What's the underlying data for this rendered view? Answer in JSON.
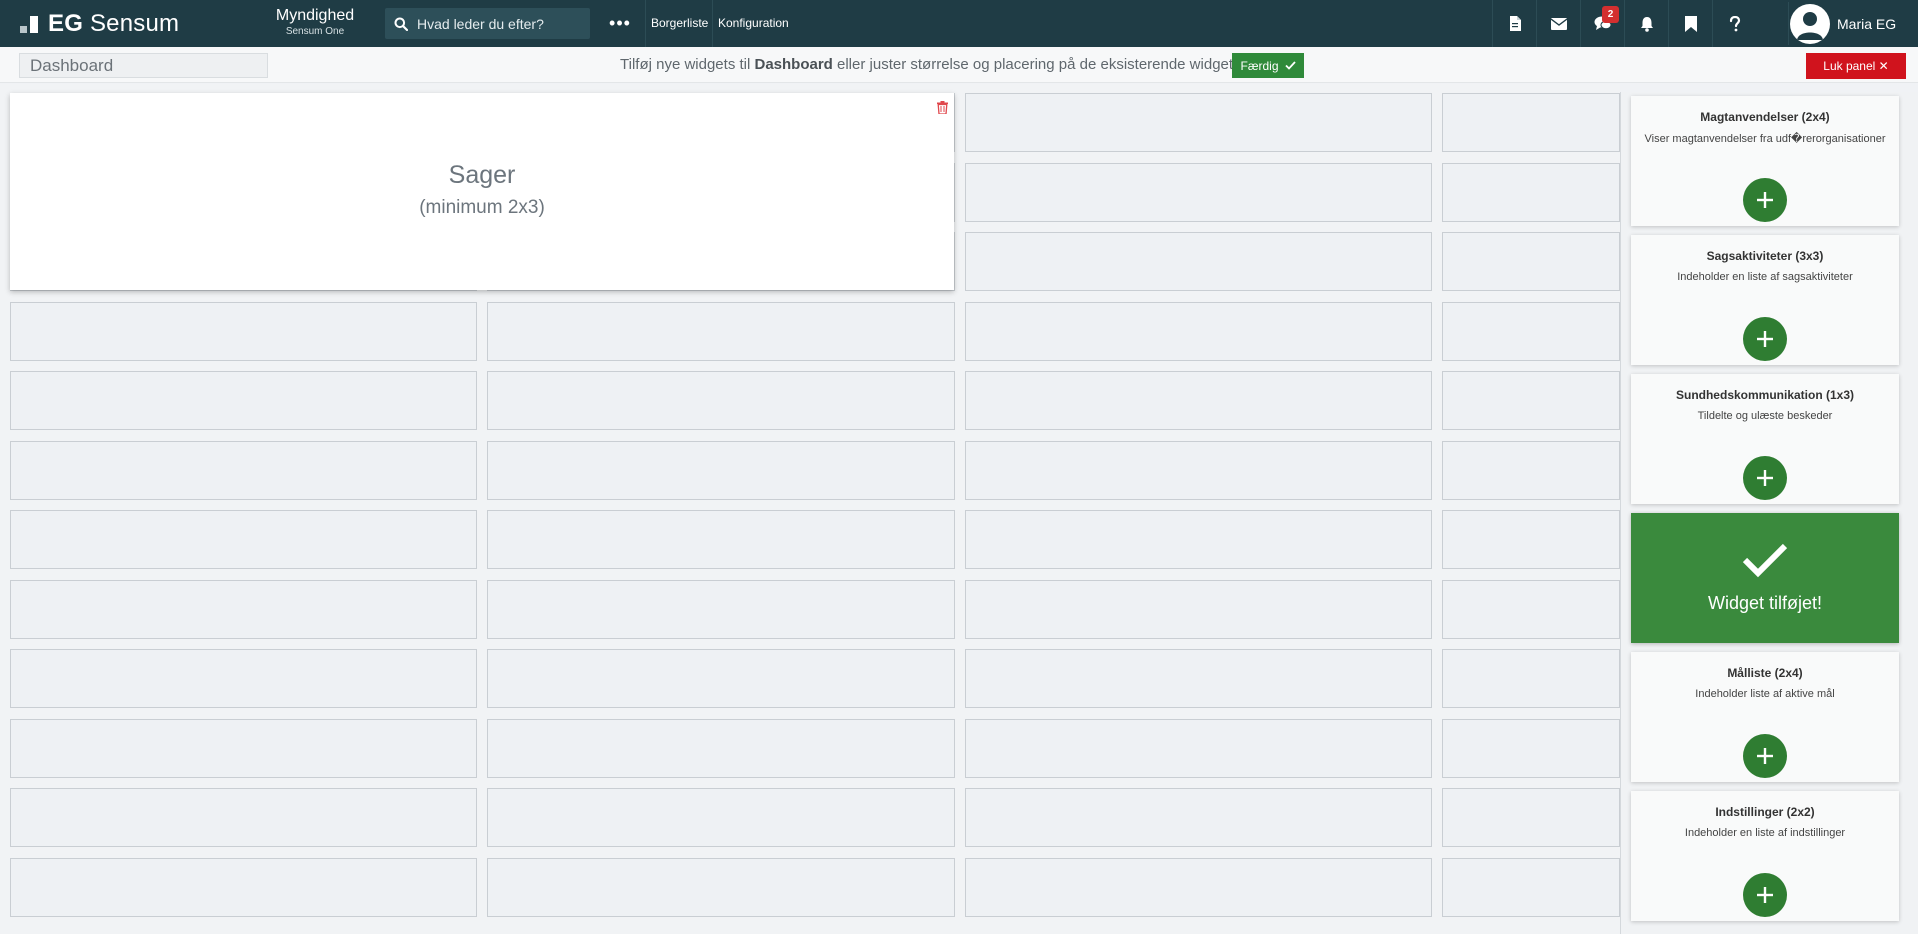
{
  "header": {
    "logo_text_bold": "EG",
    "logo_text": "Sensum",
    "context_title": "Myndighed",
    "context_subtitle": "Sensum One",
    "search_placeholder": "Hvad leder du efter?",
    "more_label": "•••",
    "nav": [
      "Borgerliste",
      "Konfiguration"
    ],
    "notification_badge": "2",
    "user_name": "Maria EG",
    "icons": [
      "document-icon",
      "envelope-icon",
      "chat-icon",
      "bell-icon",
      "bookmark-icon",
      "help-icon"
    ]
  },
  "toolbar": {
    "dashboard_name": "Dashboard",
    "hint_prefix": "Tilføj nye widgets til ",
    "hint_bold": "Dashboard",
    "hint_suffix": " eller juster størrelse og placering på de eksisterende widgets",
    "done_label": "Færdig",
    "close_label": "Luk panel ✕"
  },
  "widget": {
    "title": "Sager",
    "subtitle": "(minimum 2x3)"
  },
  "panel": {
    "cards": [
      {
        "title": "Magtanvendelser (2x4)",
        "description": "Viser magtanvendelser fra udf�rerorganisationer"
      },
      {
        "title": "Sagsaktiviteter (3x3)",
        "description": "Indeholder en liste af sagsaktiviteter"
      },
      {
        "title": "Sundhedskommunikation (1x3)",
        "description": "Tildelte og ulæste beskeder"
      },
      {
        "title": "Målliste (2x4)",
        "description": "Indeholder liste af aktive mål"
      },
      {
        "title": "Indstillinger (2x2)",
        "description": "Indeholder en liste af indstillinger"
      }
    ],
    "success_label": "Widget tilføjet!"
  },
  "colors": {
    "header_bg": "#1f3c45",
    "success_green": "#3a8a3d",
    "add_green": "#2f7d32",
    "danger_red": "#d0131d"
  }
}
